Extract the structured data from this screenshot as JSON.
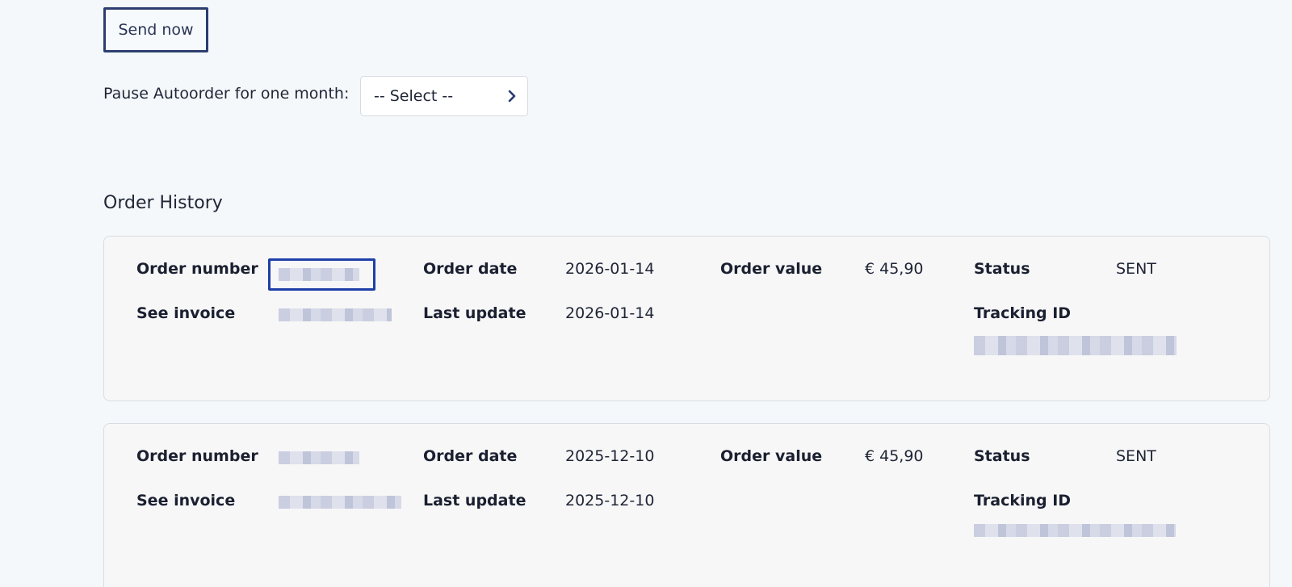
{
  "actions": {
    "send_now_label": "Send now",
    "pause_label": "Pause Autoorder for one month:",
    "pause_select_value": "-- Select --"
  },
  "history": {
    "title": "Order History",
    "labels": {
      "order_number": "Order number",
      "see_invoice": "See invoice",
      "order_date": "Order date",
      "last_update": "Last update",
      "order_value": "Order value",
      "status": "Status",
      "tracking_id": "Tracking ID"
    },
    "orders": [
      {
        "order_date": "2026-01-14",
        "last_update": "2026-01-14",
        "order_value": "€ 45,90",
        "status": "SENT"
      },
      {
        "order_date": "2025-12-10",
        "last_update": "2025-12-10",
        "order_value": "€ 45,90",
        "status": "SENT"
      }
    ]
  },
  "colors": {
    "page_bg": "#f4f8fb",
    "button_border": "#2c3e70",
    "focus_outline": "#1f3fa8",
    "card_bg": "#f7f7f8"
  },
  "icons": {
    "select_chevron": "chevron-right-icon"
  }
}
